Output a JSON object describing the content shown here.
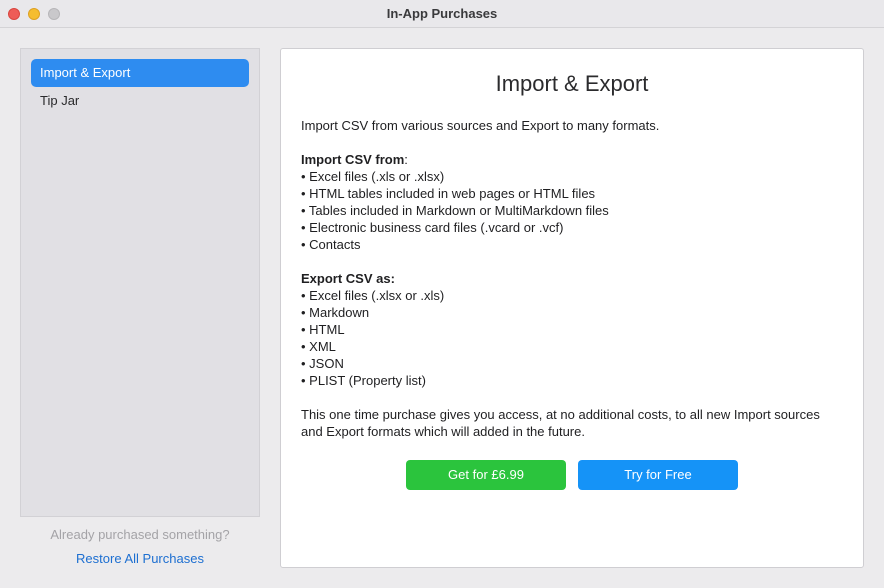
{
  "window": {
    "title": "In-App Purchases"
  },
  "sidebar": {
    "items": [
      {
        "label": "Import & Export",
        "selected": true
      },
      {
        "label": "Tip Jar",
        "selected": false
      }
    ]
  },
  "footer": {
    "already_text": "Already purchased something?",
    "restore_label": "Restore All Purchases"
  },
  "panel": {
    "title": "Import & Export",
    "intro": "Import CSV from various sources and Export to many formats.",
    "import_heading": "Import CSV from",
    "import_colon": ":",
    "import_items": [
      "• Excel files (.xls or .xlsx)",
      "• HTML tables included in web pages or HTML files",
      "• Tables included in Markdown or MultiMarkdown files",
      "• Electronic business card files (.vcard or .vcf)",
      "• Contacts"
    ],
    "export_heading": "Export CSV as:",
    "export_items": [
      "• Excel files (.xlsx or .xls)",
      "• Markdown",
      "• HTML",
      "• XML",
      "• JSON",
      "• PLIST (Property list)"
    ],
    "note": "This one time purchase gives you access, at no additional costs, to all new Import sources and Export formats which will added in the future.",
    "buy_label": "Get for £6.99",
    "try_label": "Try for Free"
  },
  "colors": {
    "accent": "#2e8cf0",
    "buy_button": "#2bc43d",
    "try_button": "#1593f7",
    "link": "#1d6fd1"
  }
}
